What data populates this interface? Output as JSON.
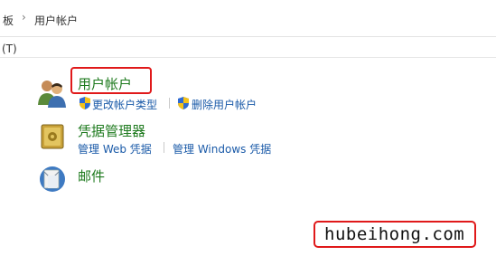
{
  "breadcrumb": {
    "parent_fragment": "板",
    "current": "用户帐户"
  },
  "menubar": {
    "item_fragment": "(T)"
  },
  "categories": [
    {
      "title": "用户帐户",
      "icon": "users-icon",
      "links": [
        {
          "label": "更改帐户类型",
          "icon": "uac-shield-icon"
        },
        {
          "label": "删除用户帐户",
          "icon": "uac-shield-icon"
        }
      ]
    },
    {
      "title": "凭据管理器",
      "icon": "credential-vault-icon",
      "links": [
        {
          "label": "管理 Web 凭据"
        },
        {
          "label": "管理 Windows 凭据"
        }
      ]
    },
    {
      "title": "邮件",
      "icon": "mail-icon",
      "links": []
    }
  ],
  "watermark": {
    "text": "hubeihong.com"
  },
  "colors": {
    "category_title": "#1e7a1e",
    "link": "#1a5aa8",
    "highlight": "#e0191a"
  }
}
